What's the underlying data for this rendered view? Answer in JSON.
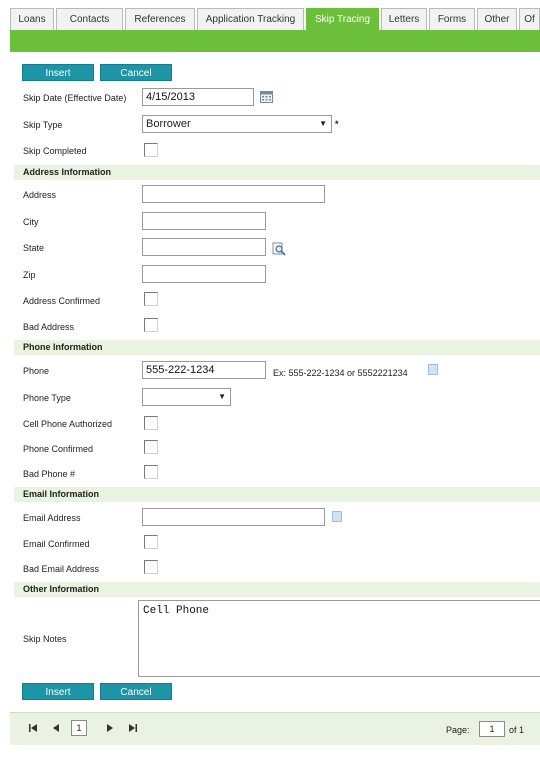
{
  "tabs": [
    "Loans",
    "Contacts",
    "References",
    "Application Tracking",
    "Skip Tracing",
    "Letters",
    "Forms",
    "Other",
    "Of"
  ],
  "buttons": {
    "insert": "Insert",
    "cancel": "Cancel"
  },
  "skip_date": {
    "label": "Skip Date (Effective Date)",
    "value": "4/15/2013"
  },
  "skip_type": {
    "label": "Skip Type",
    "value": "Borrower",
    "required_mark": "*"
  },
  "skip_completed": {
    "label": "Skip Completed"
  },
  "sections": {
    "address": "Address Information",
    "phone": "Phone Information",
    "email": "Email Information",
    "other": "Other Information"
  },
  "address": {
    "address_label": "Address",
    "city_label": "City",
    "state_label": "State",
    "zip_label": "Zip",
    "confirmed_label": "Address Confirmed",
    "bad_label": "Bad Address"
  },
  "phone": {
    "phone_label": "Phone",
    "phone_value": "555-222-1234",
    "hint": "Ex: 555-222-1234 or 5552221234",
    "type_label": "Phone Type",
    "cell_auth_label": "Cell Phone Authorized",
    "confirmed_label": "Phone Confirmed",
    "bad_label": "Bad Phone #"
  },
  "email": {
    "address_label": "Email Address",
    "confirmed_label": "Email Confirmed",
    "bad_label": "Bad Email Address"
  },
  "other": {
    "notes_label": "Skip Notes",
    "notes_value": "Cell Phone"
  },
  "pager": {
    "current": "1",
    "page_label": "Page:",
    "page_value": "1",
    "of_label": "of 1"
  },
  "icons": [
    "calendar-icon",
    "lookup-icon",
    "notes-icon",
    "first-page-icon",
    "prev-page-icon",
    "next-page-icon",
    "last-page-icon"
  ]
}
